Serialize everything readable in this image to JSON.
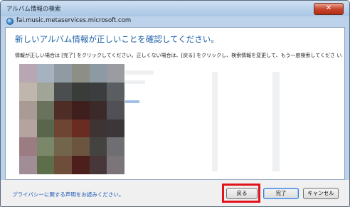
{
  "window": {
    "title": "アルバム情報の検索",
    "close_glyph": "✕",
    "url": "fai.music.metaservices.microsoft.com"
  },
  "content": {
    "heading": "新しいアルバム情報が正しいことを確認してください。",
    "instructions": "情報が正しい場合は [完了] をクリックしてください。正しくない場合は、[戻る] をクリックし、検索情報を変更して、もう一度検索してくださ い。"
  },
  "footer": {
    "privacy_link": "プライバシーに関する声明をお読みください。",
    "back_button": "戻る",
    "finish_button": "完了",
    "cancel_button": "キャンセル"
  },
  "colors": {
    "heading": "#1b5fa8",
    "link": "#1a56b5",
    "highlight": "#e1141b"
  }
}
